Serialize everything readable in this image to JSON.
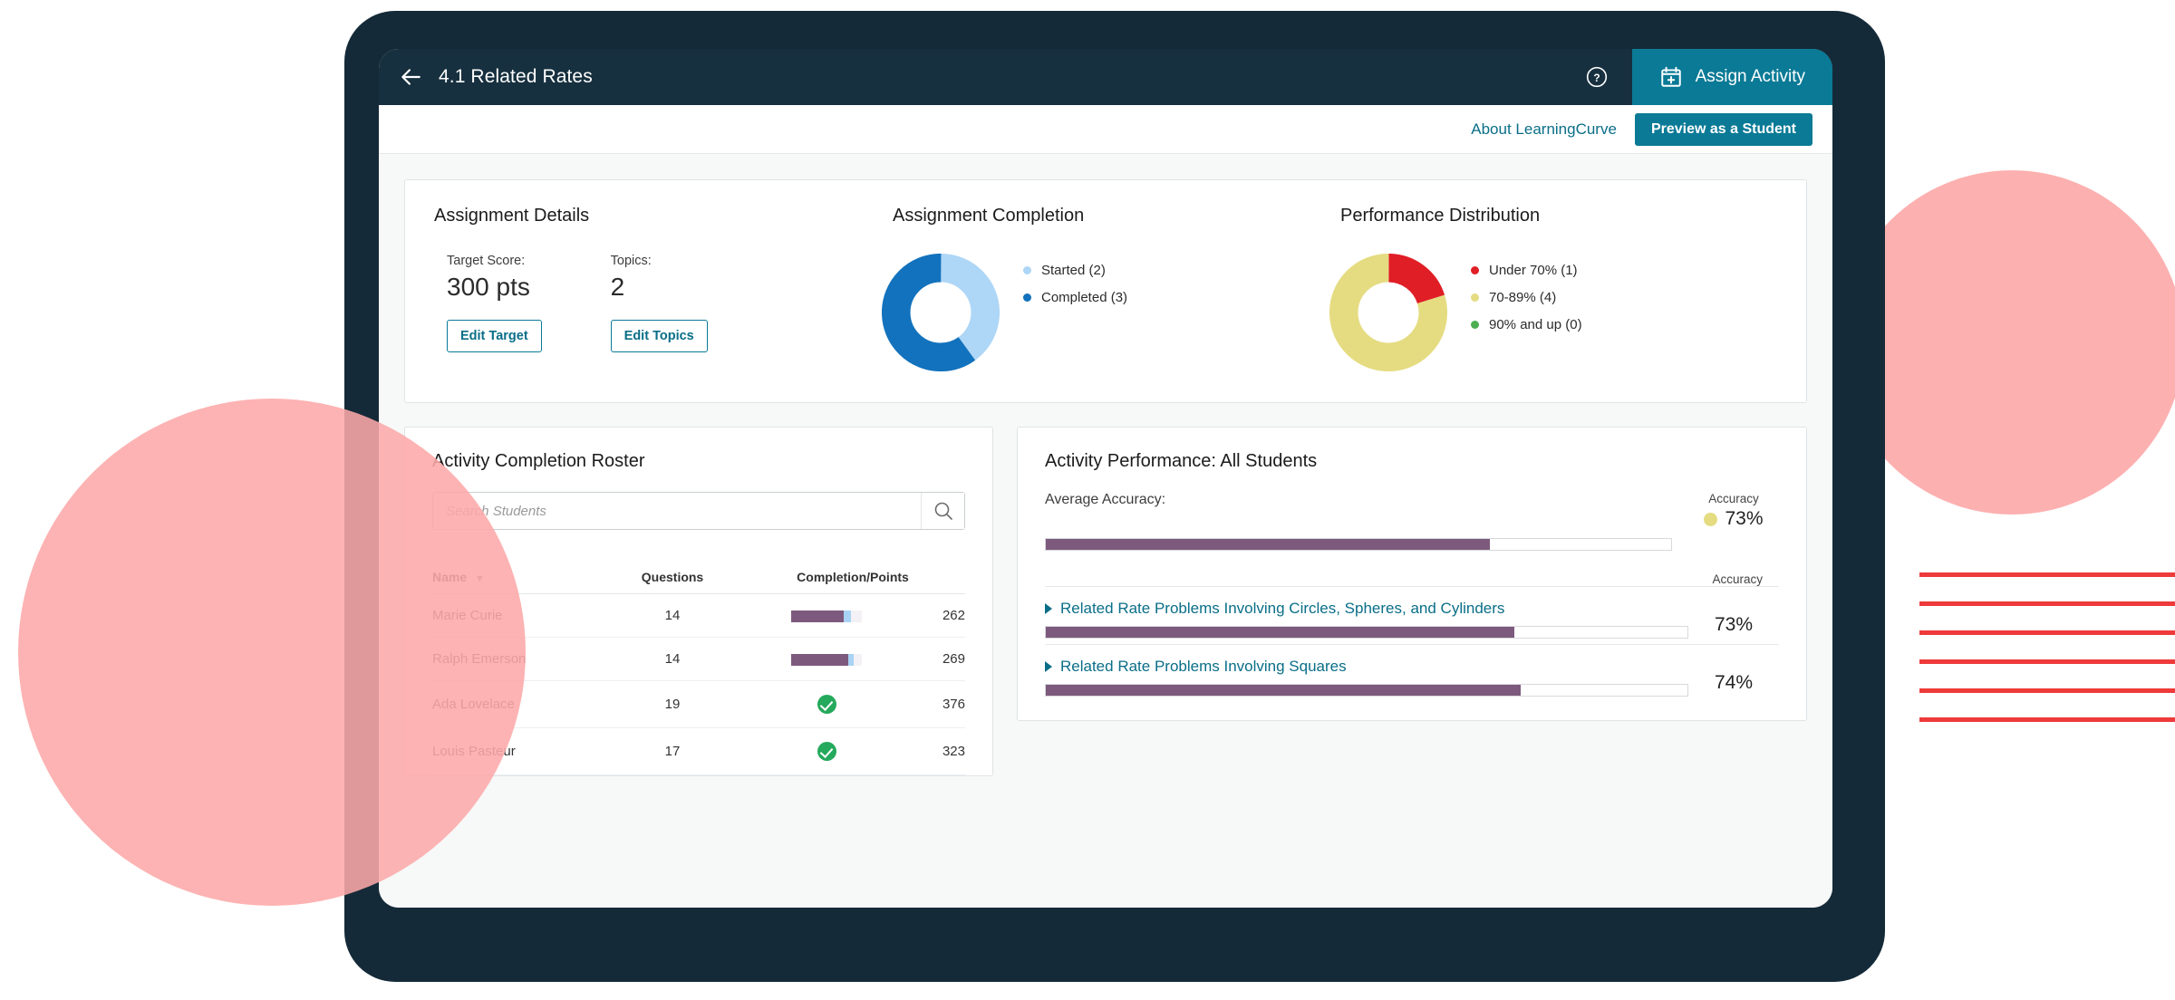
{
  "header": {
    "back_icon": "back-arrow-icon",
    "title": "4.1 Related Rates",
    "help_icon": "help-circle-icon",
    "assign_icon": "calendar-plus-icon",
    "assign_label": "Assign Activity"
  },
  "subheader": {
    "about_link": "About LearningCurve",
    "preview_button": "Preview as a Student"
  },
  "assignment_details": {
    "title": "Assignment Details",
    "target_score_label": "Target Score:",
    "target_score_value": "300 pts",
    "topics_label": "Topics:",
    "topics_value": "2",
    "edit_target_button": "Edit Target",
    "edit_topics_button": "Edit Topics"
  },
  "assignment_completion": {
    "title": "Assignment Completion"
  },
  "performance_distribution": {
    "title": "Performance Distribution"
  },
  "roster": {
    "title": "Activity Completion Roster",
    "search_placeholder": "Search Students",
    "search_value": "",
    "search_icon": "search-icon",
    "columns": [
      "Name",
      "Questions",
      "Completion/Points"
    ],
    "sort_icon": "sort-descending-icon",
    "rows": [
      {
        "name": "Marie Curie",
        "questions": "14",
        "completed": false,
        "progress": 74,
        "tip": 10,
        "points": "262"
      },
      {
        "name": "Ralph Emerson",
        "questions": "14",
        "completed": false,
        "progress": 81,
        "tip": 7,
        "points": "269"
      },
      {
        "name": "Ada Lovelace",
        "questions": "19",
        "completed": true,
        "progress": 100,
        "tip": 0,
        "points": "376"
      },
      {
        "name": "Louis Pasteur",
        "questions": "17",
        "completed": true,
        "progress": 100,
        "tip": 0,
        "points": "323"
      }
    ]
  },
  "performance": {
    "title": "Activity Performance: All Students",
    "average_label": "Average Accuracy:",
    "accuracy_header": "Accuracy",
    "average_value": "73%",
    "average_pct": 71,
    "accuracy_subheader": "Accuracy",
    "topics": [
      {
        "name": "Related Rate Problems Involving Circles, Spheres, and Cylinders",
        "value": "73%",
        "pct": 73,
        "expand_icon": "triangle-right-icon"
      },
      {
        "name": "Related Rate Problems Involving Squares",
        "value": "74%",
        "pct": 74,
        "expand_icon": "triangle-right-icon"
      }
    ]
  },
  "colors": {
    "brand_teal": "#0A7A96",
    "header_dark": "#17303F",
    "link_teal": "#0A6E87",
    "bar_purple": "#7D5A7D",
    "bar_tip_blue": "#A8D3F5",
    "check_green": "#25A95C",
    "accent_pink": "#FDA9A9",
    "accent_red": "#EE3A3A"
  },
  "chart_data": [
    {
      "type": "pie",
      "title": "Assignment Completion",
      "labels": [
        "Started (2)",
        "Completed (3)"
      ],
      "names": [
        "Started",
        "Completed"
      ],
      "values": [
        2,
        3
      ],
      "colors": [
        "#AED6F6",
        "#1272BD"
      ],
      "donut": true,
      "legend_position": "right"
    },
    {
      "type": "pie",
      "title": "Performance Distribution",
      "labels": [
        "Under 70% (1)",
        "70-89% (4)",
        "90% and up (0)"
      ],
      "names": [
        "Under 70%",
        "70-89%",
        "90% and up"
      ],
      "values": [
        1,
        4,
        0
      ],
      "colors": [
        "#E01E26",
        "#E5DC82",
        "#4CAF50"
      ],
      "donut": true,
      "legend_position": "right"
    },
    {
      "type": "bar",
      "title": "Activity Performance: All Students",
      "orientation": "horizontal",
      "categories": [
        "Average Accuracy",
        "Related Rate Problems Involving Circles, Spheres, and Cylinders",
        "Related Rate Problems Involving Squares"
      ],
      "values": [
        73,
        73,
        74
      ],
      "ylabel": "Accuracy",
      "xlim": [
        0,
        100
      ]
    },
    {
      "type": "table",
      "title": "Activity Completion Roster",
      "columns": [
        "Name",
        "Questions",
        "Completion/Points"
      ],
      "rows": [
        [
          "Marie Curie",
          14,
          262
        ],
        [
          "Ralph Emerson",
          14,
          269
        ],
        [
          "Ada Lovelace",
          19,
          376
        ],
        [
          "Louis Pasteur",
          17,
          323
        ]
      ]
    }
  ]
}
